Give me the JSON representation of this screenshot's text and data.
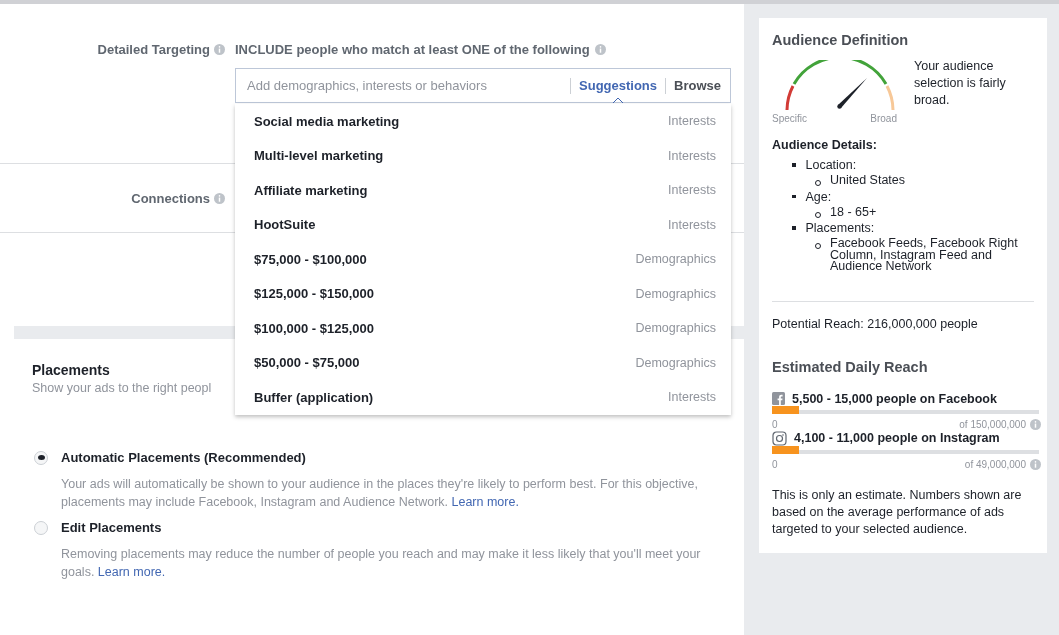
{
  "targeting": {
    "label": "Detailed Targeting",
    "include_text": "INCLUDE people who match at least ONE of the following",
    "search": {
      "placeholder": "Add demographics, interests or behaviors"
    },
    "tabs": [
      {
        "label": "Suggestions",
        "selected": true
      },
      {
        "label": "Browse",
        "selected": false
      }
    ],
    "suggestions": [
      {
        "name": "Social media marketing",
        "category": "Interests"
      },
      {
        "name": "Multi-level marketing",
        "category": "Interests"
      },
      {
        "name": "Affiliate marketing",
        "category": "Interests"
      },
      {
        "name": "HootSuite",
        "category": "Interests"
      },
      {
        "name": "$75,000 - $100,000",
        "category": "Demographics"
      },
      {
        "name": "$125,000 - $150,000",
        "category": "Demographics"
      },
      {
        "name": "$100,000 - $125,000",
        "category": "Demographics"
      },
      {
        "name": "$50,000 - $75,000",
        "category": "Demographics"
      },
      {
        "name": "Buffer (application)",
        "category": "Interests"
      }
    ]
  },
  "connections": {
    "label": "Connections"
  },
  "placements": {
    "title": "Placements",
    "subtitle": "Show your ads to the right peopl",
    "options": [
      {
        "label": "Automatic Placements (Recommended)",
        "selected": true,
        "description": "Your ads will automatically be shown to your audience in the places they're likely to perform best. For this objective, placements may include Facebook, Instagram and Audience Network.",
        "link": "Learn more."
      },
      {
        "label": "Edit Placements",
        "selected": false,
        "description": "Removing placements may reduce the number of people you reach and may make it less likely that you'll meet your goals.",
        "link": "Learn more."
      }
    ]
  },
  "audience": {
    "title": "Audience Definition",
    "gauge_min": "Specific",
    "gauge_max": "Broad",
    "summary": "Your audience selection is fairly broad.",
    "details_title": "Audience Details:",
    "details": [
      {
        "label": "Location:",
        "children": [
          {
            "label": "United States"
          }
        ]
      },
      {
        "label": "Age:",
        "children": [
          {
            "label": "18 - 65+"
          }
        ]
      },
      {
        "label": "Placements:",
        "children": [
          {
            "label": "Facebook Feeds, Facebook Right Column, Instagram Feed and Audience Network"
          }
        ]
      }
    ],
    "potential_reach": "Potential Reach: 216,000,000 people",
    "daily_title": "Estimated Daily Reach",
    "reach": [
      {
        "kind": "facebook",
        "text": "5,500 - 15,000 people on Facebook",
        "level": 0.1,
        "min": "0",
        "max": "of 150,000,000"
      },
      {
        "kind": "instagram",
        "text": "4,100 - 11,000 people on Instagram",
        "level": 0.1,
        "min": "0",
        "max": "of 49,000,000"
      }
    ],
    "note": "This is only an estimate. Numbers shown are based on the average performance of ads targeted to your selected audience."
  }
}
